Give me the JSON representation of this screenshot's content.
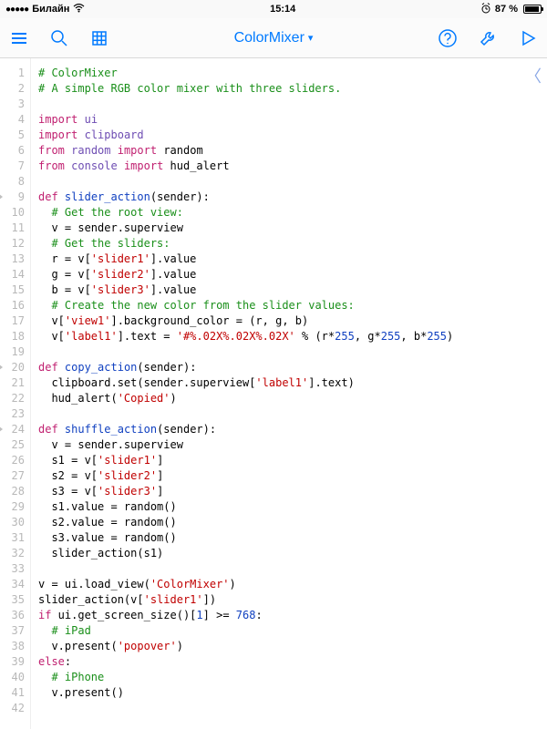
{
  "status": {
    "signal_dots": "●●●●●",
    "carrier": "Билайн",
    "wifi": "wifi-icon",
    "time": "15:14",
    "alarm": "alarm-icon",
    "battery_pct": "87 %"
  },
  "toolbar": {
    "menu": "menu-icon",
    "search": "search-icon",
    "grid": "grid-icon",
    "title": "ColorMixer",
    "dropdown_glyph": "▾",
    "help": "help-icon",
    "wrench": "wrench-icon",
    "run": "run-icon"
  },
  "editor": {
    "back_glyph": "〈",
    "lines": [
      {
        "n": 1,
        "fold": false,
        "seg": [
          [
            "c-comment",
            "# ColorMixer"
          ]
        ]
      },
      {
        "n": 2,
        "fold": false,
        "seg": [
          [
            "c-comment",
            "# A simple RGB color mixer with three sliders."
          ]
        ]
      },
      {
        "n": 3,
        "fold": false,
        "seg": [
          [
            "",
            ""
          ]
        ]
      },
      {
        "n": 4,
        "fold": false,
        "seg": [
          [
            "c-keyword",
            "import"
          ],
          [
            "",
            " "
          ],
          [
            "c-builtin",
            "ui"
          ]
        ]
      },
      {
        "n": 5,
        "fold": false,
        "seg": [
          [
            "c-keyword",
            "import"
          ],
          [
            "",
            " "
          ],
          [
            "c-builtin",
            "clipboard"
          ]
        ]
      },
      {
        "n": 6,
        "fold": false,
        "seg": [
          [
            "c-keyword",
            "from"
          ],
          [
            "",
            " "
          ],
          [
            "c-builtin",
            "random"
          ],
          [
            "",
            " "
          ],
          [
            "c-keyword",
            "import"
          ],
          [
            "",
            " random"
          ]
        ]
      },
      {
        "n": 7,
        "fold": false,
        "seg": [
          [
            "c-keyword",
            "from"
          ],
          [
            "",
            " "
          ],
          [
            "c-builtin",
            "console"
          ],
          [
            "",
            " "
          ],
          [
            "c-keyword",
            "import"
          ],
          [
            "",
            " hud_alert"
          ]
        ]
      },
      {
        "n": 8,
        "fold": false,
        "seg": [
          [
            "",
            ""
          ]
        ]
      },
      {
        "n": 9,
        "fold": true,
        "seg": [
          [
            "c-keyword",
            "def"
          ],
          [
            "",
            " "
          ],
          [
            "c-def",
            "slider_action"
          ],
          [
            "",
            "(sender):"
          ]
        ]
      },
      {
        "n": 10,
        "fold": false,
        "seg": [
          [
            "",
            "  "
          ],
          [
            "c-comment",
            "# Get the root view:"
          ]
        ]
      },
      {
        "n": 11,
        "fold": false,
        "seg": [
          [
            "",
            "  v = sender.superview"
          ]
        ]
      },
      {
        "n": 12,
        "fold": false,
        "seg": [
          [
            "",
            "  "
          ],
          [
            "c-comment",
            "# Get the sliders:"
          ]
        ]
      },
      {
        "n": 13,
        "fold": false,
        "seg": [
          [
            "",
            "  r = v["
          ],
          [
            "c-string",
            "'slider1'"
          ],
          [
            "",
            "].value"
          ]
        ]
      },
      {
        "n": 14,
        "fold": false,
        "seg": [
          [
            "",
            "  g = v["
          ],
          [
            "c-string",
            "'slider2'"
          ],
          [
            "",
            "].value"
          ]
        ]
      },
      {
        "n": 15,
        "fold": false,
        "seg": [
          [
            "",
            "  b = v["
          ],
          [
            "c-string",
            "'slider3'"
          ],
          [
            "",
            "].value"
          ]
        ]
      },
      {
        "n": 16,
        "fold": false,
        "seg": [
          [
            "",
            "  "
          ],
          [
            "c-comment",
            "# Create the new color from the slider values:"
          ]
        ]
      },
      {
        "n": 17,
        "fold": false,
        "seg": [
          [
            "",
            "  v["
          ],
          [
            "c-string",
            "'view1'"
          ],
          [
            "",
            "].background_color = (r, g, b)"
          ]
        ]
      },
      {
        "n": 18,
        "fold": false,
        "seg": [
          [
            "",
            "  v["
          ],
          [
            "c-string",
            "'label1'"
          ],
          [
            "",
            "].text = "
          ],
          [
            "c-string",
            "'#%.02X%.02X%.02X'"
          ],
          [
            "",
            " % (r*"
          ],
          [
            "c-number",
            "255"
          ],
          [
            "",
            ", g*"
          ],
          [
            "c-number",
            "255"
          ],
          [
            "",
            ", b*"
          ],
          [
            "c-number",
            "255"
          ],
          [
            "",
            ")"
          ]
        ]
      },
      {
        "n": 19,
        "fold": false,
        "seg": [
          [
            "",
            ""
          ]
        ]
      },
      {
        "n": 20,
        "fold": true,
        "seg": [
          [
            "c-keyword",
            "def"
          ],
          [
            "",
            " "
          ],
          [
            "c-def",
            "copy_action"
          ],
          [
            "",
            "(sender):"
          ]
        ]
      },
      {
        "n": 21,
        "fold": false,
        "seg": [
          [
            "",
            "  clipboard.set(sender.superview["
          ],
          [
            "c-string",
            "'label1'"
          ],
          [
            "",
            "].text)"
          ]
        ]
      },
      {
        "n": 22,
        "fold": false,
        "seg": [
          [
            "",
            "  hud_alert("
          ],
          [
            "c-string",
            "'Copied'"
          ],
          [
            "",
            ")"
          ]
        ]
      },
      {
        "n": 23,
        "fold": false,
        "seg": [
          [
            "",
            ""
          ]
        ]
      },
      {
        "n": 24,
        "fold": true,
        "seg": [
          [
            "c-keyword",
            "def"
          ],
          [
            "",
            " "
          ],
          [
            "c-def",
            "shuffle_action"
          ],
          [
            "",
            "(sender):"
          ]
        ]
      },
      {
        "n": 25,
        "fold": false,
        "seg": [
          [
            "",
            "  v = sender.superview"
          ]
        ]
      },
      {
        "n": 26,
        "fold": false,
        "seg": [
          [
            "",
            "  s1 = v["
          ],
          [
            "c-string",
            "'slider1'"
          ],
          [
            "",
            "]"
          ]
        ]
      },
      {
        "n": 27,
        "fold": false,
        "seg": [
          [
            "",
            "  s2 = v["
          ],
          [
            "c-string",
            "'slider2'"
          ],
          [
            "",
            "]"
          ]
        ]
      },
      {
        "n": 28,
        "fold": false,
        "seg": [
          [
            "",
            "  s3 = v["
          ],
          [
            "c-string",
            "'slider3'"
          ],
          [
            "",
            "]"
          ]
        ]
      },
      {
        "n": 29,
        "fold": false,
        "seg": [
          [
            "",
            "  s1.value = random()"
          ]
        ]
      },
      {
        "n": 30,
        "fold": false,
        "seg": [
          [
            "",
            "  s2.value = random()"
          ]
        ]
      },
      {
        "n": 31,
        "fold": false,
        "seg": [
          [
            "",
            "  s3.value = random()"
          ]
        ]
      },
      {
        "n": 32,
        "fold": false,
        "seg": [
          [
            "",
            "  slider_action(s1)"
          ]
        ]
      },
      {
        "n": 33,
        "fold": false,
        "seg": [
          [
            "",
            ""
          ]
        ]
      },
      {
        "n": 34,
        "fold": false,
        "seg": [
          [
            "",
            "v = ui.load_view("
          ],
          [
            "c-string",
            "'ColorMixer'"
          ],
          [
            "",
            ")"
          ]
        ]
      },
      {
        "n": 35,
        "fold": false,
        "seg": [
          [
            "",
            "slider_action(v["
          ],
          [
            "c-string",
            "'slider1'"
          ],
          [
            "",
            "])"
          ]
        ]
      },
      {
        "n": 36,
        "fold": false,
        "seg": [
          [
            "c-keyword",
            "if"
          ],
          [
            "",
            " ui.get_screen_size()["
          ],
          [
            "c-number",
            "1"
          ],
          [
            "",
            "] >= "
          ],
          [
            "c-number",
            "768"
          ],
          [
            "",
            ":"
          ]
        ]
      },
      {
        "n": 37,
        "fold": false,
        "seg": [
          [
            "",
            "  "
          ],
          [
            "c-comment",
            "# iPad"
          ]
        ]
      },
      {
        "n": 38,
        "fold": false,
        "seg": [
          [
            "",
            "  v.present("
          ],
          [
            "c-string",
            "'popover'"
          ],
          [
            "",
            ")"
          ]
        ]
      },
      {
        "n": 39,
        "fold": false,
        "seg": [
          [
            "c-keyword",
            "else"
          ],
          [
            "",
            ":"
          ]
        ]
      },
      {
        "n": 40,
        "fold": false,
        "seg": [
          [
            "",
            "  "
          ],
          [
            "c-comment",
            "# iPhone"
          ]
        ]
      },
      {
        "n": 41,
        "fold": false,
        "seg": [
          [
            "",
            "  v.present()"
          ]
        ]
      },
      {
        "n": 42,
        "fold": false,
        "seg": [
          [
            "",
            ""
          ]
        ]
      }
    ]
  }
}
